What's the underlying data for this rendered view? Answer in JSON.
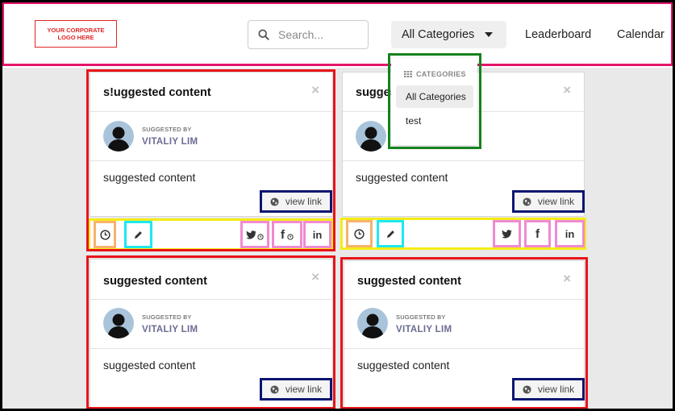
{
  "header": {
    "logo_text": "YOUR CORPORATE LOGO HERE",
    "search_placeholder": "Search...",
    "category_button": "All Categories",
    "nav": [
      "Leaderboard",
      "Calendar"
    ]
  },
  "dropdown": {
    "heading": "CATEGORIES",
    "items": [
      "All Categories",
      "test"
    ]
  },
  "cards": [
    {
      "title": "s!uggested content",
      "by_label": "SUGGESTED BY",
      "author": "VITALIY LIM",
      "body": "suggested content",
      "view_link": "view link"
    },
    {
      "title": "sugges",
      "by_label": "SUGGESTED BY",
      "author": "VITALIY LIM",
      "body": "suggested content",
      "view_link": "view link"
    },
    {
      "title": "suggested content",
      "by_label": "SUGGESTED BY",
      "author": "VITALIY LIM",
      "body": "suggested content",
      "view_link": "view link"
    },
    {
      "title": "suggested content",
      "by_label": "SUGGESTED BY",
      "author": "VITALIY LIM",
      "body": "suggested content",
      "view_link": "view link"
    }
  ],
  "close_symbol": "×",
  "social": {
    "linkedin": "in",
    "facebook": "f"
  },
  "colors": {
    "header_annotation": "#e6156b",
    "card_annotation": "#e8141a",
    "dropdown_annotation": "#15821f",
    "view_link_annotation": "#0a1670",
    "action_row_annotation": "#f5ec16",
    "schedule_annotation": "#f7b36b",
    "edit_annotation": "#1ee8f0",
    "share_annotation": "#f08ad2",
    "author_color": "#6b6b94",
    "logo_color": "#e32626"
  },
  "icons": [
    "search-icon",
    "caret-down-icon",
    "grid-icon",
    "close-icon",
    "avatar-icon",
    "globe-icon",
    "clock-icon",
    "pencil-icon",
    "twitter-icon",
    "facebook-icon",
    "linkedin-icon"
  ]
}
